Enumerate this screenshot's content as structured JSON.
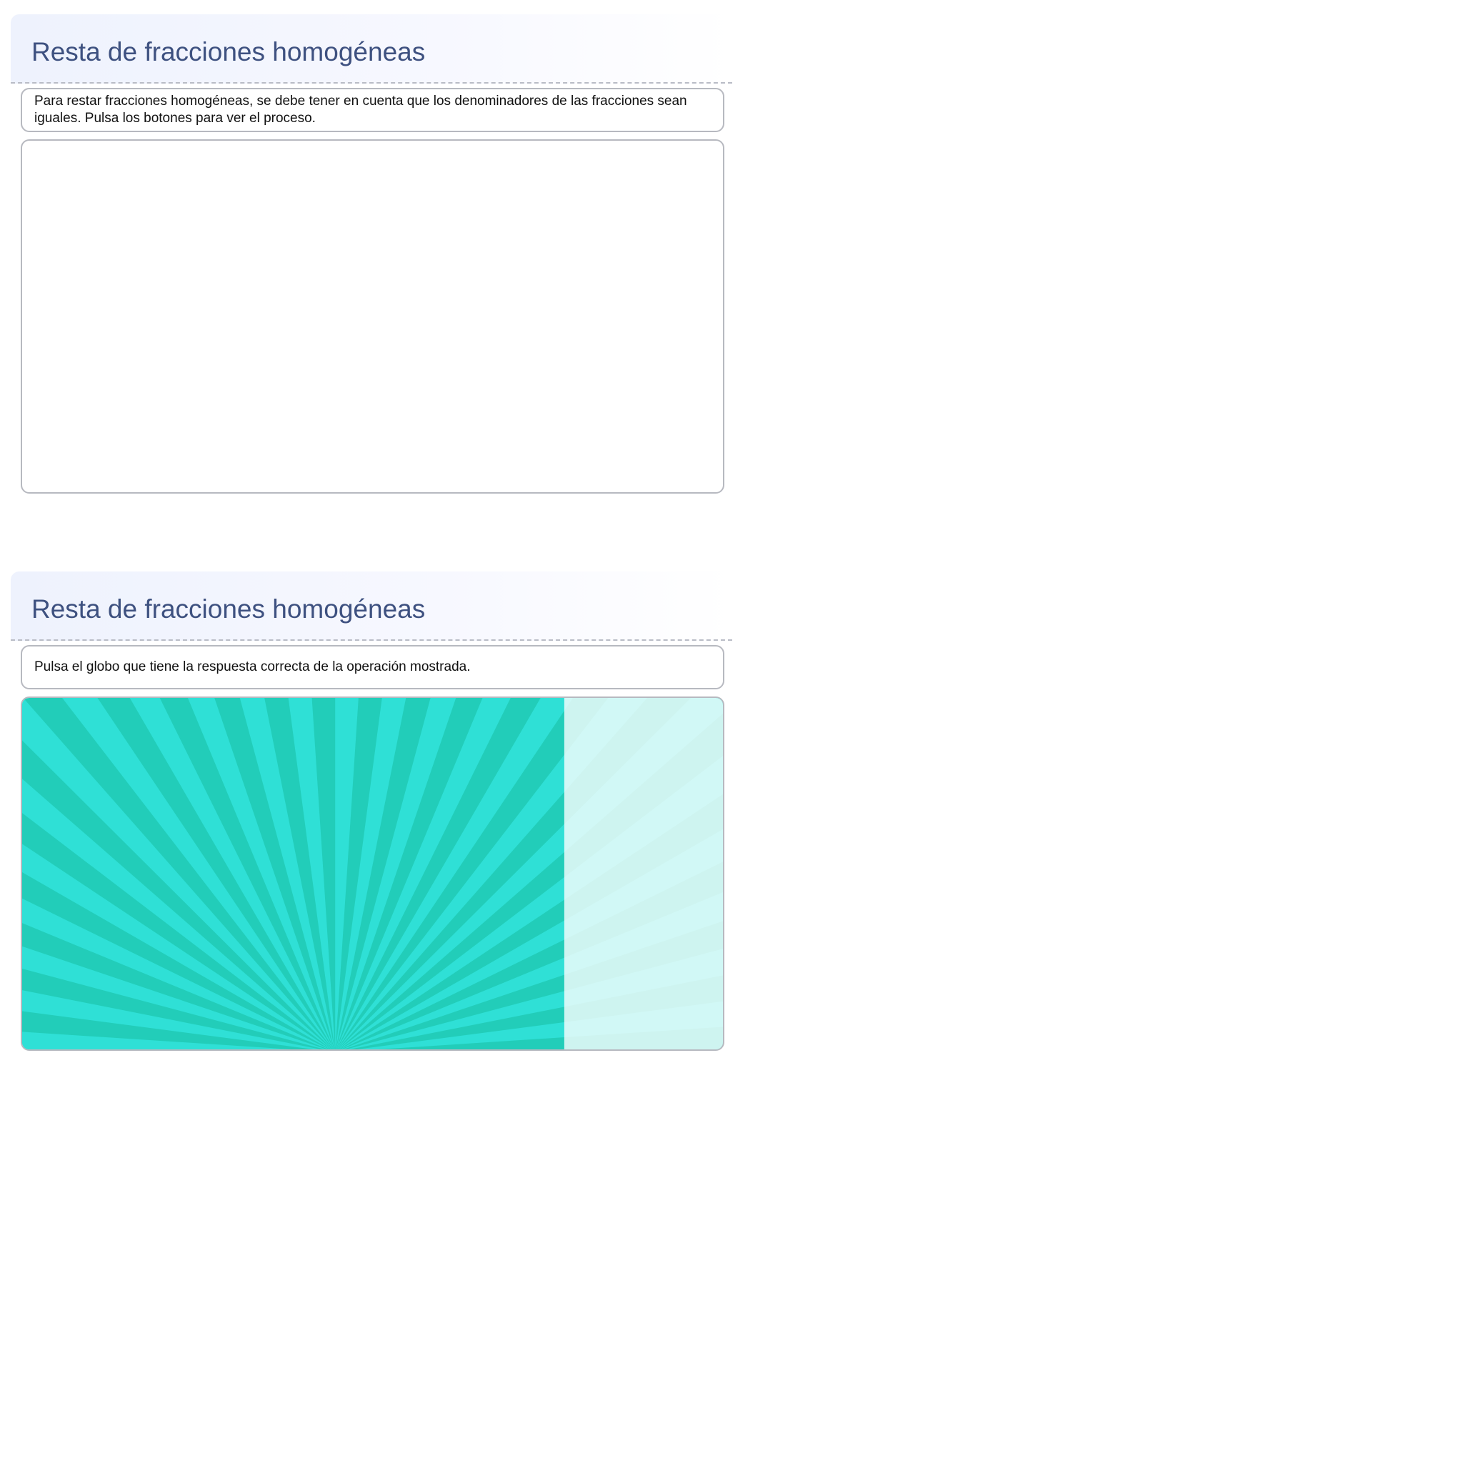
{
  "activity_1": {
    "title": "Resta de fracciones homogéneas",
    "instruction": "Para restar fracciones homogéneas, se debe tener en cuenta que los denominadores de las fracciones sean iguales. Pulsa los botones para ver el proceso."
  },
  "activity_2": {
    "title": "Resta de fracciones homogéneas",
    "instruction": "Pulsa el globo que tiene la respuesta correcta de la operación mostrada.",
    "game_background": {
      "ray_color_dark": "#22cdb9",
      "ray_color_light": "#2fe0d6",
      "fade_overlay_color": "#ffffff"
    }
  }
}
